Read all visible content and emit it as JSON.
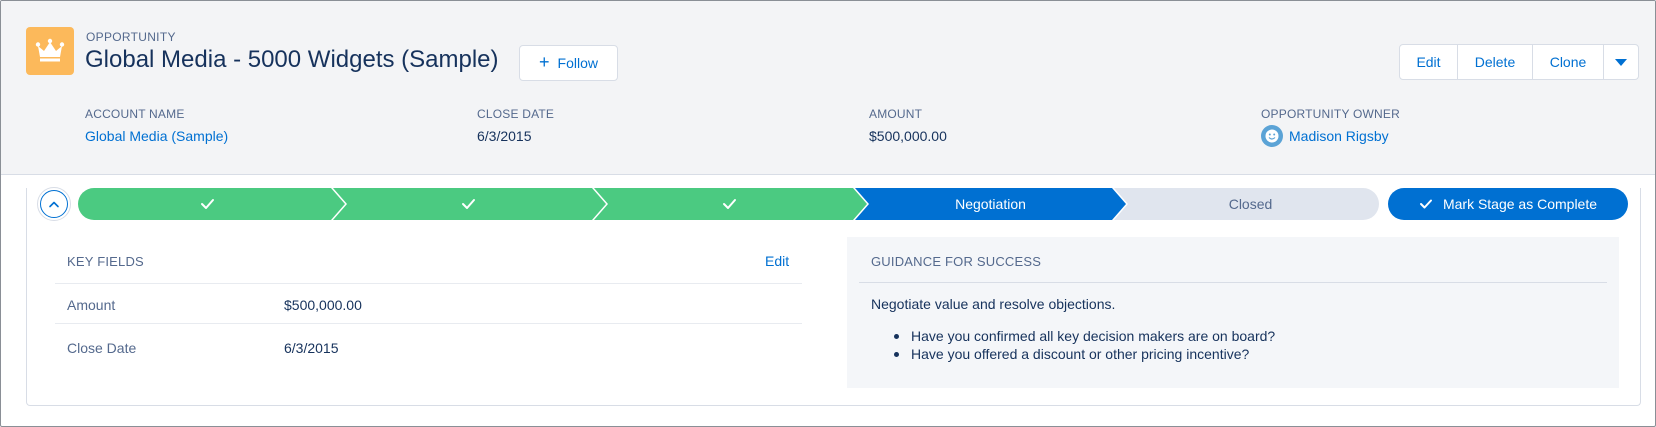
{
  "header": {
    "record_type": "OPPORTUNITY",
    "title": "Global Media - 5000 Widgets (Sample)",
    "icon": "crown-icon",
    "icon_color": "#fcb95b",
    "follow_label": "Follow",
    "actions": {
      "edit": "Edit",
      "delete": "Delete",
      "clone": "Clone",
      "more_icon": "caret-down-icon"
    }
  },
  "highlights": [
    {
      "label": "ACCOUNT NAME",
      "value": "Global Media (Sample)"
    },
    {
      "label": "CLOSE DATE",
      "value": "6/3/2015"
    },
    {
      "label": "AMOUNT",
      "value": "$500,000.00"
    },
    {
      "label": "OPPORTUNITY OWNER",
      "value": "Madison Rigsby"
    }
  ],
  "path": {
    "stages": [
      {
        "label": "",
        "status": "complete"
      },
      {
        "label": "",
        "status": "complete"
      },
      {
        "label": "",
        "status": "complete"
      },
      {
        "label": "Negotiation",
        "status": "current"
      },
      {
        "label": "Closed",
        "status": "incomplete"
      }
    ],
    "mark_complete_label": "Mark Stage as Complete"
  },
  "key_fields": {
    "title": "KEY FIELDS",
    "edit_label": "Edit",
    "rows": [
      {
        "label": "Amount",
        "value": "$500,000.00"
      },
      {
        "label": "Close Date",
        "value": "6/3/2015"
      }
    ]
  },
  "guidance": {
    "title": "GUIDANCE FOR SUCCESS",
    "heading": "Negotiate value and resolve objections.",
    "items": [
      "Have you confirmed all key decision makers are on board?",
      "Have you offered a discount or other pricing incentive?"
    ]
  },
  "colors": {
    "complete": "#4bca81",
    "current": "#0070d2",
    "incomplete": "#e0e5ee",
    "link": "#0070d2"
  }
}
